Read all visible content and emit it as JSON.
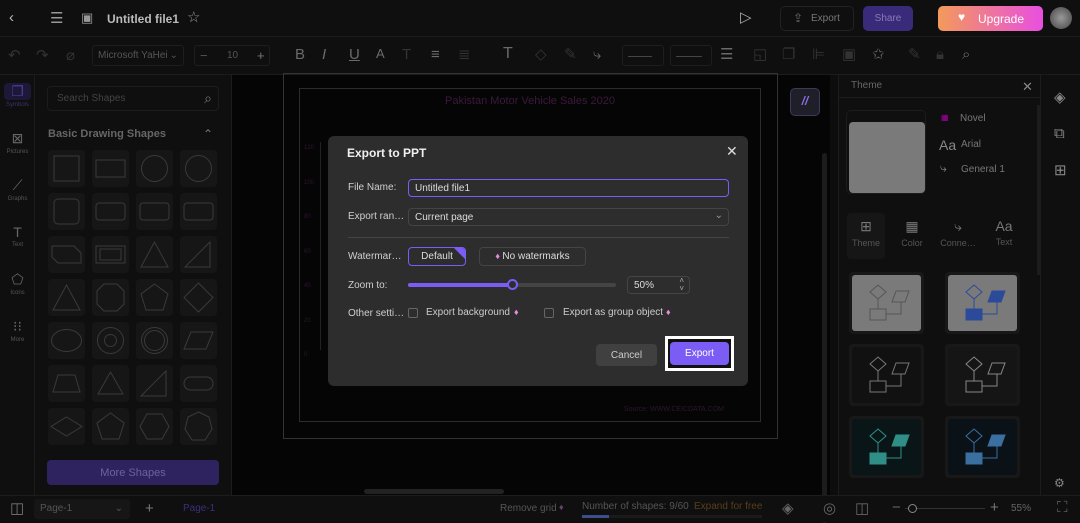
{
  "header": {
    "file_title": "Untitled file1",
    "export_label": "Export",
    "share_label": "Share",
    "upgrade_label": "Upgrade"
  },
  "toolbar": {
    "font_family": "Microsoft YaHei",
    "font_size": "10"
  },
  "rail": {
    "items": [
      {
        "label": "Symbols",
        "icon": "symbols-icon"
      },
      {
        "label": "Pictures",
        "icon": "pictures-icon"
      },
      {
        "label": "Graphs",
        "icon": "graphs-icon"
      },
      {
        "label": "Text",
        "icon": "text-icon"
      },
      {
        "label": "Icons",
        "icon": "icons-icon"
      },
      {
        "label": "More",
        "icon": "more-grid-icon"
      }
    ]
  },
  "shapes_panel": {
    "search_placeholder": "Search Shapes",
    "section_title": "Basic Drawing Shapes",
    "more_label": "More Shapes",
    "shapes": [
      "square",
      "rectangle",
      "circle",
      "circle",
      "rounded-square",
      "rounded-rectangle",
      "rounded-rectangle",
      "rounded-rectangle",
      "snip-rectangle",
      "double-rectangle",
      "triangle",
      "right-triangle",
      "triangle",
      "octagon",
      "pentagon",
      "diamond",
      "ellipse",
      "donut",
      "double-circle",
      "parallelogram",
      "trapezoid",
      "rounded-triangle",
      "right-triangle",
      "pill",
      "diamond-wide",
      "pentagon",
      "hexagon",
      "heptagon"
    ]
  },
  "canvas": {
    "chart_title": "Pakistan Motor Vehicle Sales 2020",
    "y_ticks": [
      "120",
      "100",
      "80",
      "60",
      "40",
      "20",
      "0"
    ],
    "source": "Source: WWW.CEICDATA.COM"
  },
  "dialog": {
    "title": "Export to PPT",
    "file_name_label": "File Name:",
    "file_name_value": "Untitled file1",
    "range_label": "Export ran…",
    "range_value": "Current page",
    "watermark_label": "Watermar…",
    "watermark_default": "Default",
    "watermark_none": "No watermarks",
    "zoom_label": "Zoom to:",
    "zoom_value": "50%",
    "zoom_percent": 50,
    "other_label": "Other setti…",
    "export_background": "Export background",
    "export_group": "Export as group object",
    "cancel_label": "Cancel",
    "export_label": "Export"
  },
  "theme_panel": {
    "title": "Theme",
    "theme_name": "Novel",
    "font_name": "Arial",
    "connector_name": "General 1",
    "tabs": [
      "Theme",
      "Color",
      "Conne…",
      "Text"
    ]
  },
  "bottom": {
    "page_select": "Page-1",
    "page_tab": "Page-1",
    "remove_grid": "Remove grid",
    "shape_count": "Number of shapes: 9/60",
    "expand": "Expand for free",
    "zoom": "55%"
  },
  "colors": {
    "accent": "#7b5cf5",
    "upgrade_start": "#f39a5a",
    "upgrade_end": "#e94fe0",
    "share": "#3a2a7a"
  }
}
